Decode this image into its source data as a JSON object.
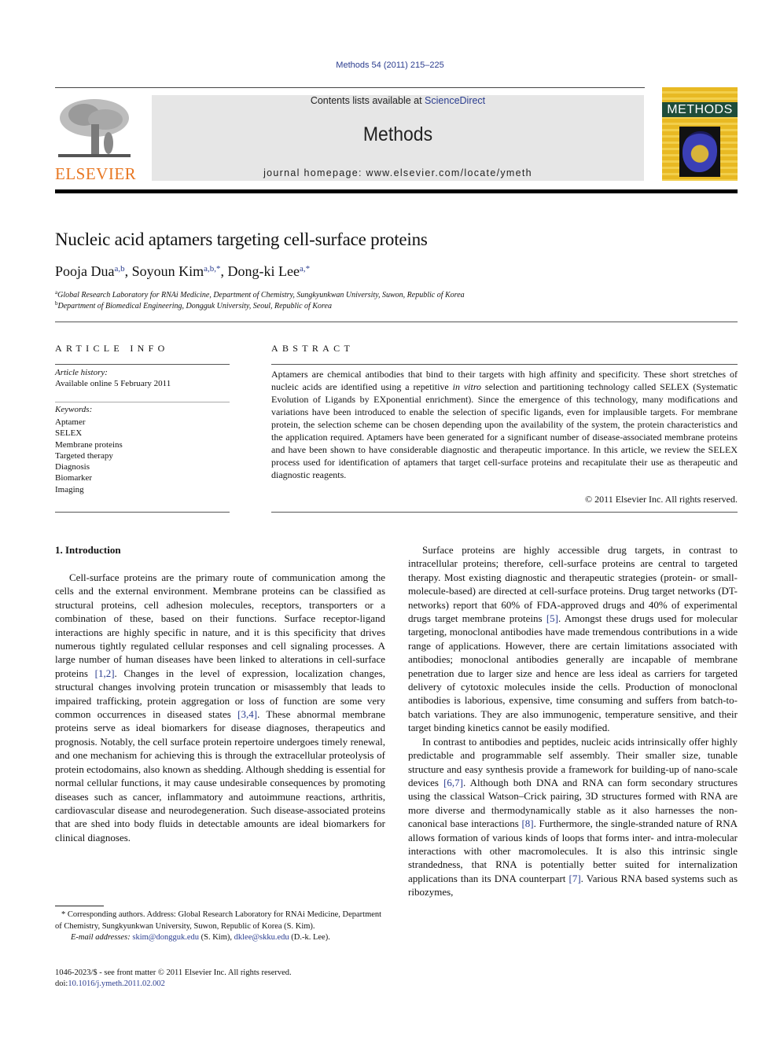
{
  "header": {
    "journal_ref": "Methods 54 (2011) 215–225",
    "publisher_logo_text": "ELSEVIER",
    "contents_prefix": "Contents lists available at ",
    "contents_link": "ScienceDirect",
    "journal_name": "Methods",
    "homepage": "journal homepage: www.elsevier.com/locate/ymeth",
    "cover_title": "METHODS"
  },
  "article": {
    "title": "Nucleic acid aptamers targeting cell-surface proteins",
    "authors": [
      {
        "name": "Pooja Dua",
        "sup": "a,b",
        "sep": ", "
      },
      {
        "name": "Soyoun Kim",
        "sup": "a,b,*",
        "sep": ", "
      },
      {
        "name": "Dong-ki Lee",
        "sup": "a,*",
        "sep": ""
      }
    ],
    "affiliations": [
      {
        "mark": "a",
        "text": "Global Research Laboratory for RNAi Medicine, Department of Chemistry, Sungkyunkwan University, Suwon, Republic of Korea"
      },
      {
        "mark": "b",
        "text": "Department of Biomedical Engineering, Dongguk University, Seoul, Republic of Korea"
      }
    ]
  },
  "article_info": {
    "heading": "ARTICLE INFO",
    "history_label": "Article history:",
    "history_value": "Available online 5 February 2011",
    "keywords_label": "Keywords:",
    "keywords": [
      "Aptamer",
      "SELEX",
      "Membrane proteins",
      "Targeted therapy",
      "Diagnosis",
      "Biomarker",
      "Imaging"
    ]
  },
  "abstract": {
    "heading": "ABSTRACT",
    "text_1": "Aptamers are chemical antibodies that bind to their targets with high affinity and specificity. These short stretches of nucleic acids are identified using a repetitive ",
    "text_italic": "in vitro",
    "text_2": " selection and partitioning technology called SELEX (Systematic Evolution of Ligands by EXponential enrichment). Since the emergence of this technology, many modifications and variations have been introduced to enable the selection of specific ligands, even for implausible targets. For membrane protein, the selection scheme can be chosen depending upon the availability of the system, the protein characteristics and the application required. Aptamers have been generated for a significant number of disease-associated membrane proteins and have been shown to have considerable diagnostic and therapeutic importance. In this article, we review the SELEX process used for identification of aptamers that target cell-surface proteins and recapitulate their use as therapeutic and diagnostic reagents.",
    "copyright": "© 2011 Elsevier Inc. All rights reserved."
  },
  "body": {
    "section_heading": "1. Introduction",
    "left_p1": [
      "Cell-surface proteins are the primary route of communication among the cells and the external environment. Membrane proteins can be classified as structural proteins, cell adhesion molecules, receptors, transporters or a combination of these, based on their functions. Surface receptor-ligand interactions are highly specific in nature, and it is this specificity that drives numerous tightly regulated cellular responses and cell signaling processes. A large number of human diseases have been linked to alterations in cell-surface proteins ",
      "[1,2]",
      ". Changes in the level of expression, localization changes, structural changes involving protein truncation or misassembly that leads to impaired trafficking, protein aggregation or loss of function are some very common occurrences in diseased states ",
      "[3,4]",
      ". These abnormal membrane proteins serve as ideal biomarkers for disease diagnoses, therapeutics and prognosis. Notably, the cell surface protein repertoire undergoes timely renewal, and one mechanism for achieving this is through the extracellular proteolysis of protein ectodomains, also known as shedding. Although shedding is essential for normal cellular functions, it may cause undesirable consequences by promoting diseases such as cancer, inflammatory and autoimmune reactions, arthritis, cardiovascular disease and neurodegeneration. Such disease-associated proteins that are shed into body fluids in detectable amounts are ideal biomarkers for clinical diagnoses."
    ],
    "right_p1": [
      "Surface proteins are highly accessible drug targets, in contrast to intracellular proteins; therefore, cell-surface proteins are central to targeted therapy. Most existing diagnostic and therapeutic strategies (protein- or small-molecule-based) are directed at cell-surface proteins. Drug target networks (DT-networks) report that 60% of FDA-approved drugs and 40% of experimental drugs target membrane proteins ",
      "[5]",
      ". Amongst these drugs used for molecular targeting, monoclonal antibodies have made tremendous contributions in a wide range of applications. However, there are certain limitations associated with antibodies; monoclonal antibodies generally are incapable of membrane penetration due to larger size and hence are less ideal as carriers for targeted delivery of cytotoxic molecules inside the cells. Production of monoclonal antibodies is laborious, expensive, time consuming and suffers from batch-to-batch variations. They are also immunogenic, temperature sensitive, and their target binding kinetics cannot be easily modified."
    ],
    "right_p2": [
      "In contrast to antibodies and peptides, nucleic acids intrinsically offer highly predictable and programmable self assembly. Their smaller size, tunable structure and easy synthesis provide a framework for building-up of nano-scale devices ",
      "[6,7]",
      ". Although both DNA and RNA can form secondary structures using the classical Watson–Crick pairing, 3D structures formed with RNA are more diverse and thermodynamically stable as it also harnesses the non-canonical base interactions ",
      "[8]",
      ". Furthermore, the single-stranded nature of RNA allows formation of various kinds of loops that forms inter- and intra-molecular interactions with other macromolecules. It is also this intrinsic single strandedness, that RNA is potentially better suited for internalization applications than its DNA counterpart ",
      "[7]",
      ". Various RNA based systems such as ribozymes,"
    ]
  },
  "footnotes": {
    "corresponding": "* Corresponding authors. Address: Global Research Laboratory for RNAi Medicine, Department of Chemistry, Sungkyunkwan University, Suwon, Republic of Korea (S. Kim).",
    "email_label": "E-mail addresses: ",
    "email_1": "skim@dongguk.edu",
    "email_1_who": " (S. Kim), ",
    "email_2": "dklee@skku.edu",
    "email_2_who": " (D.-k. Lee).",
    "issn_line": "1046-2023/$ - see front matter © 2011 Elsevier Inc. All rights reserved.",
    "doi_prefix": "doi:",
    "doi": "10.1016/j.ymeth.2011.02.002"
  },
  "colors": {
    "link": "#2b3d8f",
    "elsevier_orange": "#e87722",
    "banner_bg": "#e6e6e6",
    "cover_yellow": "#e8b923"
  }
}
